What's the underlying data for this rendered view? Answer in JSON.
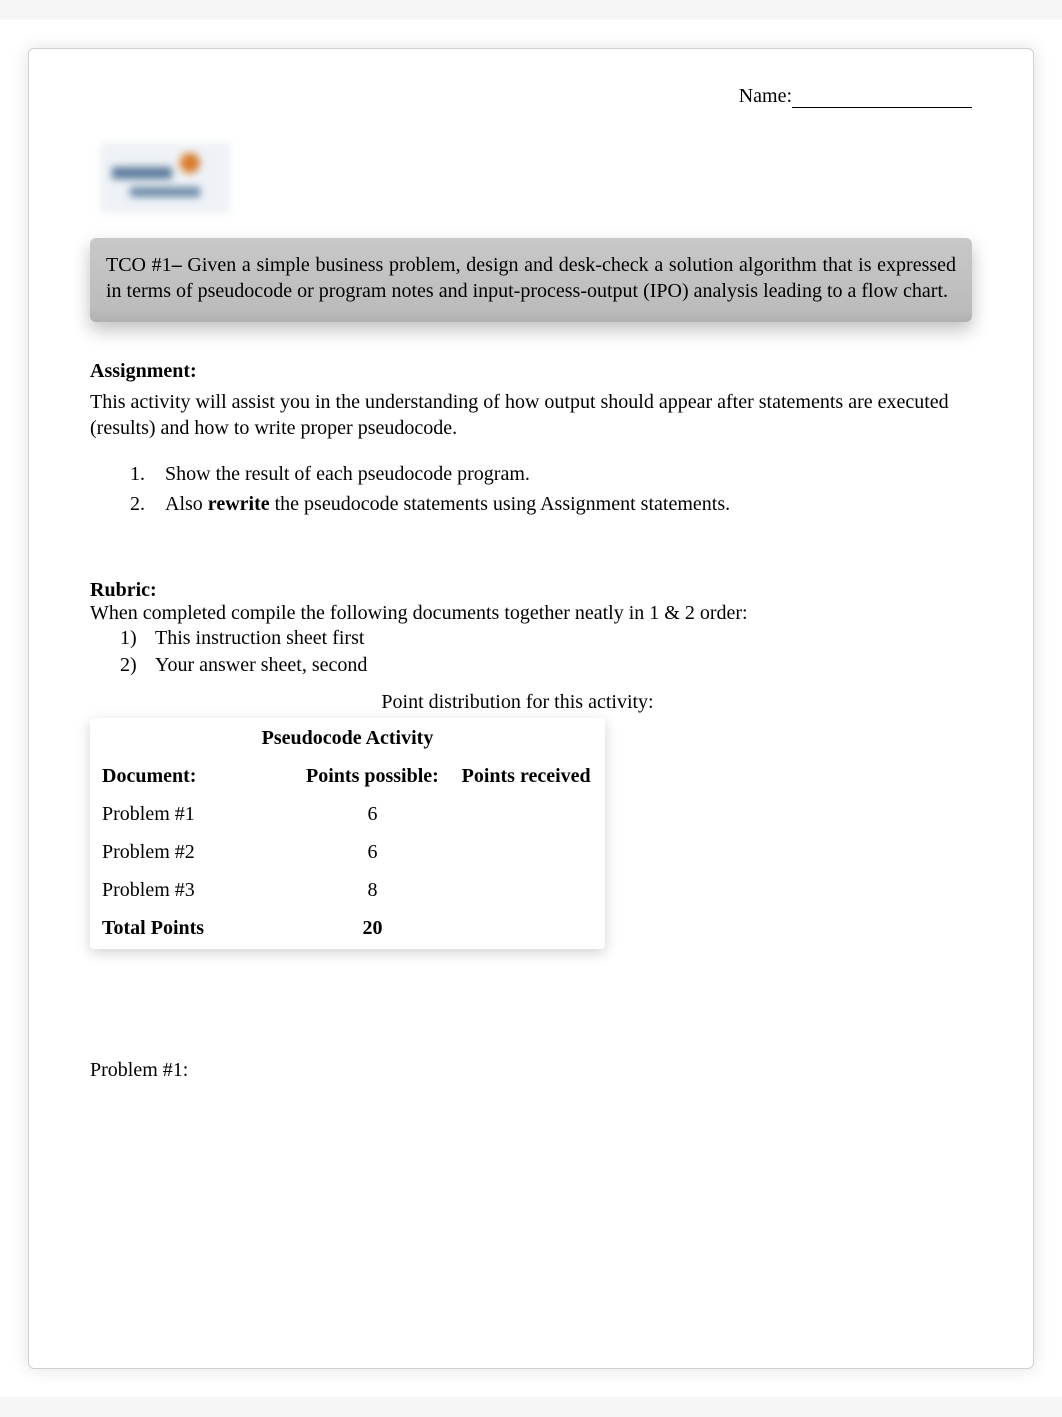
{
  "header": {
    "name_label": "Name:"
  },
  "tco": {
    "prefix": "TCO #1",
    "dash": "– ",
    "text": "Given a simple business problem, design and desk-check a solution algorithm that is expressed in terms of pseudocode or program notes and input-process-output (IPO) analysis leading to a flow chart."
  },
  "assignment": {
    "heading": "Assignment:",
    "intro": "This activity will assist you in the understanding of how output should appear after statements are executed (results) and how to write proper pseudocode.",
    "steps": [
      {
        "num": "1.",
        "text": "Show the result of each pseudocode program."
      },
      {
        "num": "2.",
        "prefix": "Also ",
        "bold": "rewrite",
        "suffix": " the pseudocode statements using Assignment statements."
      }
    ]
  },
  "rubric": {
    "heading": "Rubric:",
    "intro": "When completed compile the following documents together neatly in 1 & 2 order:",
    "items": [
      {
        "num": "1)",
        "text": "This instruction sheet first"
      },
      {
        "num": "2)",
        "text": "Your answer sheet, second"
      }
    ]
  },
  "grade_table": {
    "caption": "Point distribution for this activity:",
    "title": "Pseudocode Activity",
    "headers": {
      "doc": "Document:",
      "possible": "Points possible:",
      "received": "Points received"
    },
    "rows": [
      {
        "doc": "Problem #1",
        "possible": "6",
        "received": ""
      },
      {
        "doc": "Problem #2",
        "possible": "6",
        "received": ""
      },
      {
        "doc": "Problem #3",
        "possible": "8",
        "received": ""
      }
    ],
    "total": {
      "label": "Total Points",
      "possible": "20",
      "received": ""
    }
  },
  "problem1": {
    "label": "Problem #1:"
  }
}
